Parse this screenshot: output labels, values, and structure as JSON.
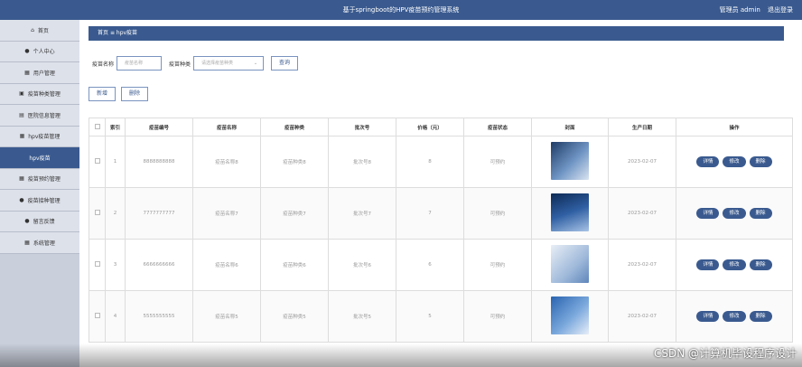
{
  "header": {
    "title": "基于springboot的HPV疫苗预约管理系统",
    "user": "管理员 admin",
    "logout": "退出登录"
  },
  "sidebar": {
    "items": [
      {
        "icon": "home-icon",
        "glyph": "⌂",
        "label": "首页"
      },
      {
        "icon": "person-icon",
        "glyph": "●",
        "label": "个人中心"
      },
      {
        "icon": "grid-icon",
        "glyph": "▦",
        "label": "用户管理"
      },
      {
        "icon": "folder-icon",
        "glyph": "▣",
        "label": "疫苗种类管理"
      },
      {
        "icon": "briefcase-icon",
        "glyph": "▤",
        "label": "医院信息管理"
      },
      {
        "icon": "grid-icon",
        "glyph": "▦",
        "label": "hpv疫苗管理"
      },
      {
        "icon": "",
        "glyph": "",
        "label": "hpv疫苗"
      },
      {
        "icon": "grid-icon",
        "glyph": "▦",
        "label": "疫苗预约管理"
      },
      {
        "icon": "person-icon",
        "glyph": "●",
        "label": "疫苗接种管理"
      },
      {
        "icon": "pin-icon",
        "glyph": "●",
        "label": "留言反馈"
      },
      {
        "icon": "grid-icon",
        "glyph": "▦",
        "label": "系统管理"
      }
    ]
  },
  "breadcrumb": {
    "home": "首页",
    "sep": "≡",
    "current": "hpv疫苗"
  },
  "filter": {
    "name_label": "疫苗名称",
    "name_placeholder": "疫苗名称",
    "type_label": "疫苗种类",
    "type_placeholder": "请选择疫苗种类",
    "query": "查询"
  },
  "actions": {
    "add": "新增",
    "delete": "删除"
  },
  "table": {
    "headers": [
      "索引",
      "疫苗编号",
      "疫苗名称",
      "疫苗种类",
      "批次号",
      "价格（元）",
      "疫苗状态",
      "封面",
      "生产日期",
      "操作"
    ],
    "rows": [
      {
        "index": "1",
        "code": "8888888888",
        "name": "疫苗名称8",
        "type": "疫苗种类8",
        "batch": "批次号8",
        "price": "8",
        "status": "可预约",
        "date": "2023-02-07"
      },
      {
        "index": "2",
        "code": "7777777777",
        "name": "疫苗名称7",
        "type": "疫苗种类7",
        "batch": "批次号7",
        "price": "7",
        "status": "可预约",
        "date": "2023-02-07"
      },
      {
        "index": "3",
        "code": "6666666666",
        "name": "疫苗名称6",
        "type": "疫苗种类6",
        "batch": "批次号6",
        "price": "6",
        "status": "可预约",
        "date": "2023-02-07"
      },
      {
        "index": "4",
        "code": "5555555555",
        "name": "疫苗名称5",
        "type": "疫苗种类5",
        "batch": "批次号5",
        "price": "5",
        "status": "可预约",
        "date": "2023-02-07"
      }
    ],
    "op": {
      "detail": "详情",
      "edit": "修改",
      "delete": "删除"
    }
  },
  "watermark": "CSDN @计算机毕设程序设计",
  "colors": {
    "primary": "#3a5a8f"
  }
}
